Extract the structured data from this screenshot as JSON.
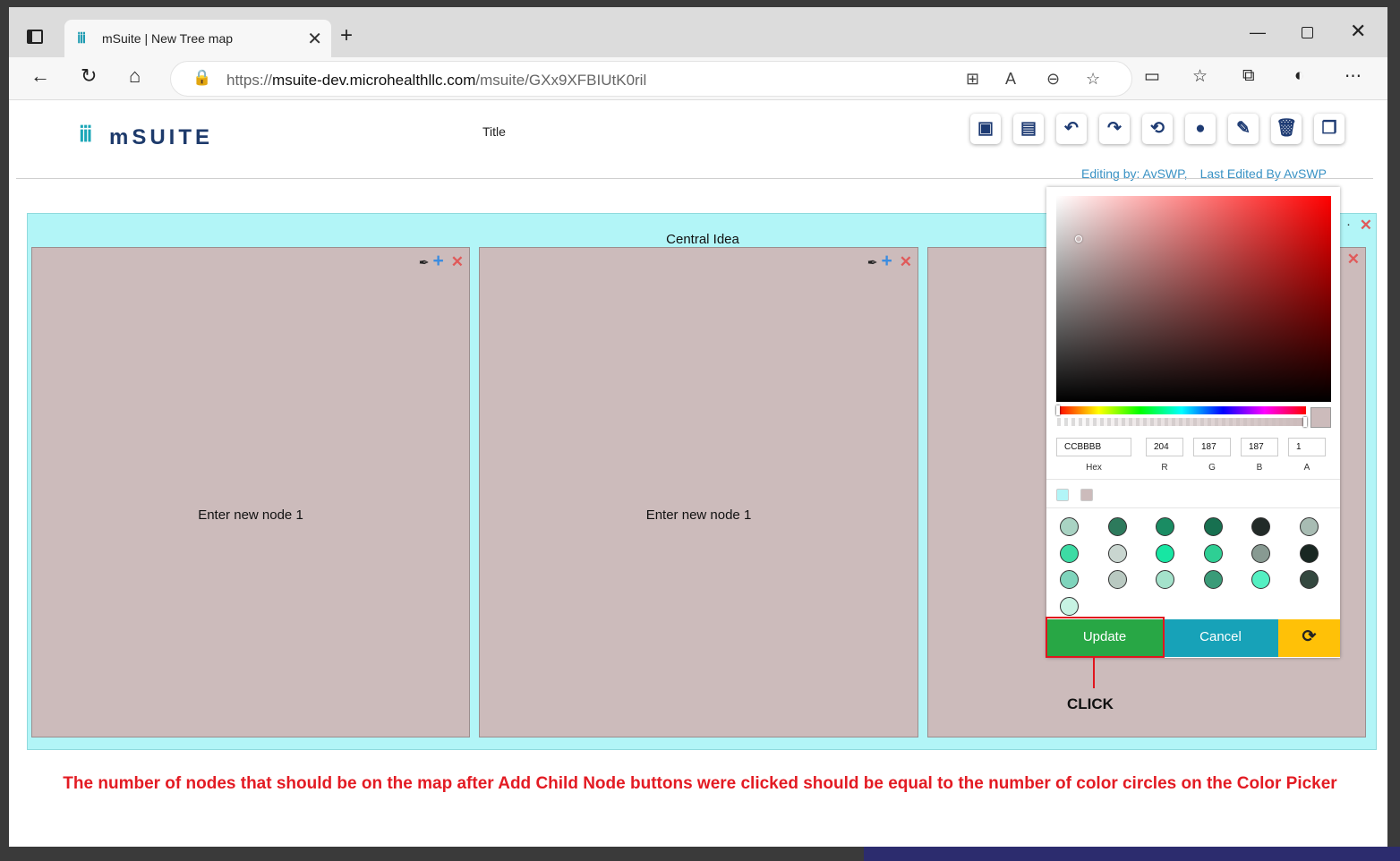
{
  "browser": {
    "tab_title": "mSuite | New Tree map",
    "tab_close": "✕",
    "new_tab": "+",
    "url_host": "msuite-dev.microhealthllc.com",
    "url_scheme": "https://",
    "url_path": "/msuite/GXx9XFBIUtK0ril",
    "window_min": "—",
    "window_close": "✕"
  },
  "app": {
    "logo_text": "mSUITE",
    "title": "Title",
    "editing_by": "Editing by: AvSWP,",
    "last_edited": "Last Edited By AvSWP",
    "toolbar_icons": [
      "image-icon",
      "save-icon",
      "undo-icon",
      "redo-icon",
      "refresh-file-icon",
      "comment-icon",
      "user-edit-icon",
      "trash-icon",
      "copy-icon"
    ]
  },
  "treemap": {
    "root_label": "Central Idea",
    "root_close": "✕",
    "root_color": "#b2f5f7",
    "nodes": [
      {
        "label": "Enter new node 1",
        "color": "#ccbbbb"
      },
      {
        "label": "Enter new node 1",
        "color": "#ccbbbb"
      },
      {
        "label": "",
        "color": "#ccbbbb"
      }
    ],
    "node_add": "+",
    "node_close": "✕"
  },
  "color_picker": {
    "hex": "CCBBBB",
    "r": "204",
    "g": "187",
    "b": "187",
    "a": "1",
    "label_hex": "Hex",
    "label_r": "R",
    "label_g": "G",
    "label_b": "B",
    "label_a": "A",
    "presets": [
      "#b2f5f7",
      "#ccbbbb"
    ],
    "palette": [
      "#a9d3c3",
      "#2d7a5c",
      "#1a8c63",
      "#177050",
      "#222b28",
      "#a8bcb3",
      "#3ddba4",
      "#c9d6d0",
      "#17e6a3",
      "#2ecf94",
      "#889a92",
      "#192722",
      "#7fd4bc",
      "#b9c9c1",
      "#a4e2cb",
      "#3a9b78",
      "#54f0c2",
      "#34483f",
      "#c7f3e3"
    ],
    "update_label": "Update",
    "cancel_label": "Cancel",
    "update_color": "#28a745",
    "cancel_color": "#17a2b8",
    "reset_color": "#ffc107"
  },
  "annotation": {
    "click_label": "CLICK",
    "note": "The number of nodes that should be on the map after Add Child Node buttons were clicked should be equal to the number of color circles on the Color Picker"
  }
}
